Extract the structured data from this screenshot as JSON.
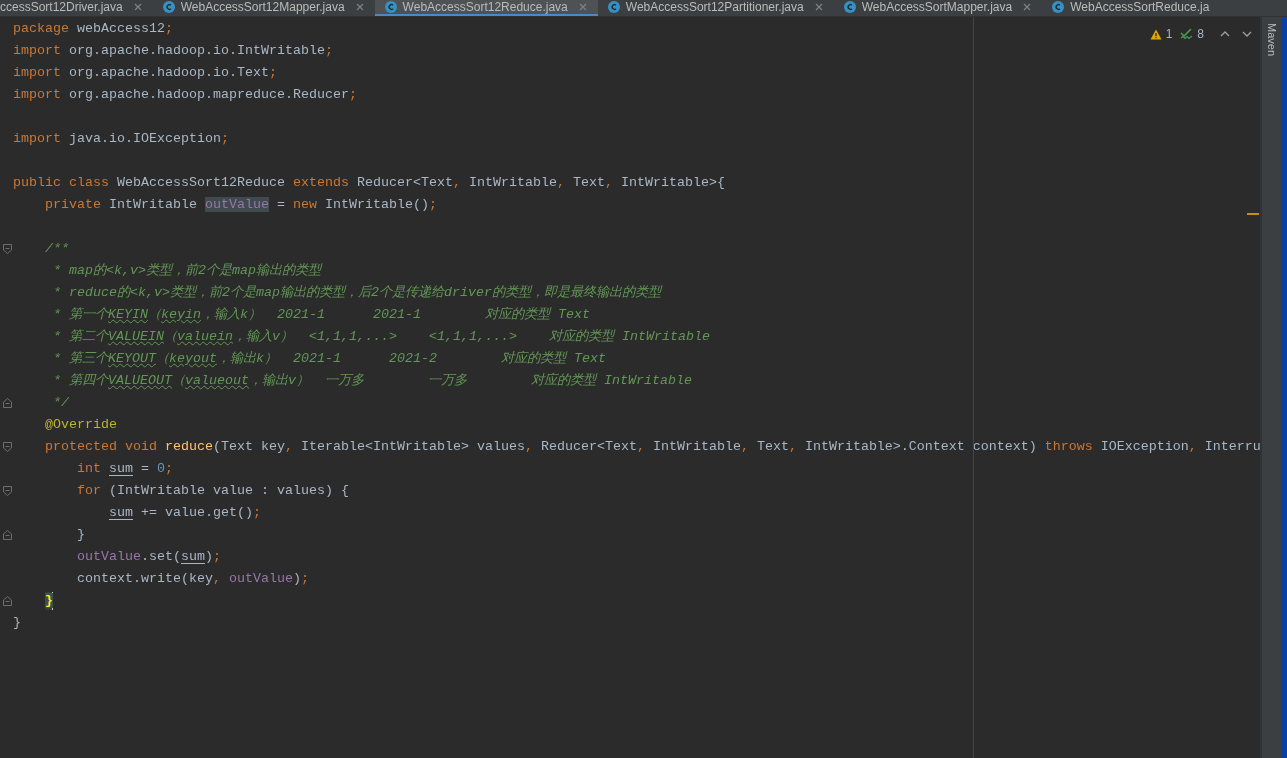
{
  "tabs": [
    {
      "label": "ccessSort12Driver.java",
      "icon": false,
      "close_button": true,
      "selected": false
    },
    {
      "label": "WebAccessSort12Mapper.java",
      "icon": true,
      "close_button": true,
      "selected": false
    },
    {
      "label": "WebAccessSort12Reduce.java",
      "icon": true,
      "close_button": true,
      "selected": true
    },
    {
      "label": "WebAccessSort12Partitioner.java",
      "icon": true,
      "close_button": true,
      "selected": false
    },
    {
      "label": "WebAccessSortMapper.java",
      "icon": true,
      "close_button": true,
      "selected": false
    },
    {
      "label": "WebAccessSortReduce.ja",
      "icon": true,
      "close_button": false,
      "selected": false
    }
  ],
  "inspections": {
    "warnings": "1",
    "weak_warnings": "8"
  },
  "code": {
    "blocks": [
      {
        "lines": [
          {
            "current": false,
            "tokens": [
              {
                "kind": "keyword",
                "text": "package"
              },
              {
                "kind": "plain",
                "text": " webAccess12"
              },
              {
                "kind": "punct",
                "text": ";"
              }
            ]
          },
          {
            "current": false,
            "tokens": [
              {
                "kind": "keyword",
                "text": "import"
              },
              {
                "kind": "plain",
                "text": " org.apache.hadoop.io.IntWritable"
              },
              {
                "kind": "punct",
                "text": ";"
              }
            ]
          },
          {
            "current": false,
            "tokens": [
              {
                "kind": "keyword",
                "text": "import"
              },
              {
                "kind": "plain",
                "text": " org.apache.hadoop.io.Text"
              },
              {
                "kind": "punct",
                "text": ";"
              }
            ]
          },
          {
            "current": false,
            "tokens": [
              {
                "kind": "keyword",
                "text": "import"
              },
              {
                "kind": "plain",
                "text": " org.apache.hadoop.mapreduce.Reducer"
              },
              {
                "kind": "punct",
                "text": ";"
              }
            ]
          }
        ]
      },
      {
        "lines": [
          {
            "current": false,
            "tokens": [
              {
                "kind": "keyword",
                "text": "import"
              },
              {
                "kind": "plain",
                "text": " java.io.IOException"
              },
              {
                "kind": "punct",
                "text": ";"
              }
            ]
          }
        ]
      },
      {
        "lines": [
          {
            "current": false,
            "tokens": [
              {
                "kind": "keyword",
                "text": "public class"
              },
              {
                "kind": "plain",
                "text": " WebAccessSort12Reduce "
              },
              {
                "kind": "keyword",
                "text": "extends"
              },
              {
                "kind": "plain",
                "text": " Reducer<Text"
              },
              {
                "kind": "punct",
                "text": ", "
              },
              {
                "kind": "plain",
                "text": "IntWritable"
              },
              {
                "kind": "punct",
                "text": ", "
              },
              {
                "kind": "plain",
                "text": "Text"
              },
              {
                "kind": "punct",
                "text": ", "
              },
              {
                "kind": "plain",
                "text": "IntWritable>{"
              }
            ]
          },
          {
            "current": false,
            "tokens": [
              {
                "kind": "keyword",
                "text": "    private"
              },
              {
                "kind": "plain",
                "text": " IntWritable "
              },
              {
                "kind": "highlighted",
                "text": "outValue"
              },
              {
                "kind": "plain",
                "text": " = "
              },
              {
                "kind": "keyword",
                "text": "new"
              },
              {
                "kind": "plain",
                "text": " IntWritable()"
              },
              {
                "kind": "punct",
                "text": ";"
              }
            ]
          }
        ]
      },
      {
        "lines": [
          {
            "current": false,
            "fold_open": true,
            "tokens": [
              {
                "kind": "comment",
                "text": "    /**"
              }
            ]
          },
          {
            "current": false,
            "tokens": [
              {
                "kind": "comment",
                "text": "     * map的<k,v>类型，前2个是map输出的类型"
              }
            ]
          },
          {
            "current": false,
            "tokens": [
              {
                "kind": "comment",
                "text": "     * reduce的<k,v>类型，前2个是map输出的类型，后2个是传递给driver的类型，即是最终输出的类型"
              }
            ]
          },
          {
            "current": false,
            "tokens": [
              {
                "kind": "comment",
                "text": "     * 第一个"
              },
              {
                "kind": "typo",
                "text": "KEYIN"
              },
              {
                "kind": "comment",
                "text": "（"
              },
              {
                "kind": "typo",
                "text": "keyin"
              },
              {
                "kind": "comment",
                "text": "，输入k）  2021-1      2021-1        对应的类型 Text"
              }
            ]
          },
          {
            "current": false,
            "tokens": [
              {
                "kind": "comment",
                "text": "     * 第二个"
              },
              {
                "kind": "typo",
                "text": "VALUEIN"
              },
              {
                "kind": "comment",
                "text": "（"
              },
              {
                "kind": "typo",
                "text": "valuein"
              },
              {
                "kind": "comment",
                "text": "，输入v）  <1,1,1,...>    <1,1,1,...>    对应的类型 IntWritable"
              }
            ]
          },
          {
            "current": false,
            "tokens": [
              {
                "kind": "comment",
                "text": "     * 第三个"
              },
              {
                "kind": "typo",
                "text": "KEYOUT"
              },
              {
                "kind": "comment",
                "text": "（"
              },
              {
                "kind": "typo",
                "text": "keyout"
              },
              {
                "kind": "comment",
                "text": "，输出k）  2021-1      2021-2        对应的类型 Text"
              }
            ]
          },
          {
            "current": false,
            "tokens": [
              {
                "kind": "comment",
                "text": "     * 第四个"
              },
              {
                "kind": "typo",
                "text": "VALUEOUT"
              },
              {
                "kind": "comment",
                "text": "（"
              },
              {
                "kind": "typo",
                "text": "valueout"
              },
              {
                "kind": "comment",
                "text": "，输出v）  一万多        一万多        对应的类型 IntWritable"
              }
            ]
          },
          {
            "current": false,
            "fold_close": true,
            "tokens": [
              {
                "kind": "comment",
                "text": "     */"
              }
            ]
          },
          {
            "current": false,
            "tokens": [
              {
                "kind": "annotation",
                "text": "    @Override"
              }
            ]
          },
          {
            "current": false,
            "fold_open": true,
            "tokens": [
              {
                "kind": "keyword",
                "text": "    protected void "
              },
              {
                "kind": "method",
                "text": "reduce"
              },
              {
                "kind": "plain",
                "text": "(Text key"
              },
              {
                "kind": "punct",
                "text": ", "
              },
              {
                "kind": "plain",
                "text": "Iterable<IntWritable> values"
              },
              {
                "kind": "punct",
                "text": ", "
              },
              {
                "kind": "plain",
                "text": "Reducer<Text"
              },
              {
                "kind": "punct",
                "text": ", "
              },
              {
                "kind": "plain",
                "text": "IntWritable"
              },
              {
                "kind": "punct",
                "text": ", "
              },
              {
                "kind": "plain",
                "text": "Text"
              },
              {
                "kind": "punct",
                "text": ", "
              },
              {
                "kind": "plain",
                "text": "IntWritable>.Context context) "
              },
              {
                "kind": "keyword",
                "text": "throws"
              },
              {
                "kind": "plain",
                "text": " IOException"
              },
              {
                "kind": "punct",
                "text": ", "
              },
              {
                "kind": "plain",
                "text": "Interru"
              }
            ]
          },
          {
            "current": false,
            "tokens": [
              {
                "kind": "keyword",
                "text": "        int "
              },
              {
                "kind": "variable",
                "text": "sum"
              },
              {
                "kind": "plain",
                "text": " = "
              },
              {
                "kind": "number",
                "text": "0"
              },
              {
                "kind": "punct",
                "text": ";"
              }
            ]
          },
          {
            "current": false,
            "fold_open": true,
            "tokens": [
              {
                "kind": "keyword",
                "text": "        for"
              },
              {
                "kind": "plain",
                "text": " (IntWritable value : values) {"
              }
            ]
          },
          {
            "current": false,
            "tokens": [
              {
                "kind": "variable",
                "text": "            sum"
              },
              {
                "kind": "plain",
                "text": " += value.get()"
              },
              {
                "kind": "punct",
                "text": ";"
              }
            ]
          },
          {
            "current": false,
            "fold_close": true,
            "tokens": [
              {
                "kind": "plain",
                "text": "        }"
              }
            ]
          },
          {
            "current": false,
            "tokens": [
              {
                "kind": "field",
                "text": "        outValue"
              },
              {
                "kind": "plain",
                "text": ".set("
              },
              {
                "kind": "variable",
                "text": "sum"
              },
              {
                "kind": "plain",
                "text": ")"
              },
              {
                "kind": "punct",
                "text": ";"
              }
            ]
          },
          {
            "current": false,
            "tokens": [
              {
                "kind": "plain",
                "text": "        context.write(key"
              },
              {
                "kind": "punct",
                "text": ", "
              },
              {
                "kind": "field",
                "text": "outValue"
              },
              {
                "kind": "plain",
                "text": ")"
              },
              {
                "kind": "punct",
                "text": ";"
              }
            ]
          },
          {
            "current": true,
            "fold_close": true,
            "tokens": [
              {
                "kind": "brace",
                "text": "    }"
              }
            ]
          },
          {
            "current": false,
            "tokens": [
              {
                "kind": "plain",
                "text": "}"
              }
            ]
          }
        ]
      }
    ]
  },
  "side_panel": {
    "label": "Maven"
  }
}
